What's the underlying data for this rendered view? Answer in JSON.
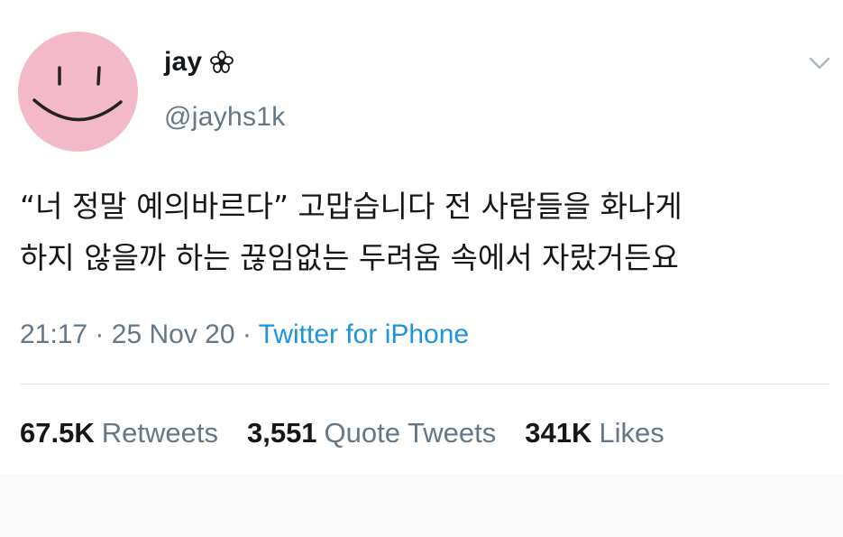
{
  "tweet": {
    "display_name": "jay",
    "handle": "@jayhs1k",
    "text_line1": "“너 정말 예의바르다” 고맙습니다 전 사람들을 화나게",
    "text_line2": "하지 않을까 하는 끊임없는 두려움 속에서 자랐거든요",
    "time": "21:17",
    "date": "25 Nov 20",
    "separator": "·",
    "source": "Twitter for iPhone"
  },
  "stats": {
    "retweets_count": "67.5K",
    "retweets_label": "Retweets",
    "quotes_count": "3,551",
    "quotes_label": "Quote Tweets",
    "likes_count": "341K",
    "likes_label": "Likes"
  },
  "colors": {
    "avatar_pink": "#f4b9c8",
    "link_blue": "#1b95e0",
    "secondary_gray": "#657786",
    "text_dark": "#14171a"
  },
  "icons": {
    "avatar": "smiley-face-avatar",
    "badge": "flower-icon",
    "menu": "chevron-down-icon"
  }
}
